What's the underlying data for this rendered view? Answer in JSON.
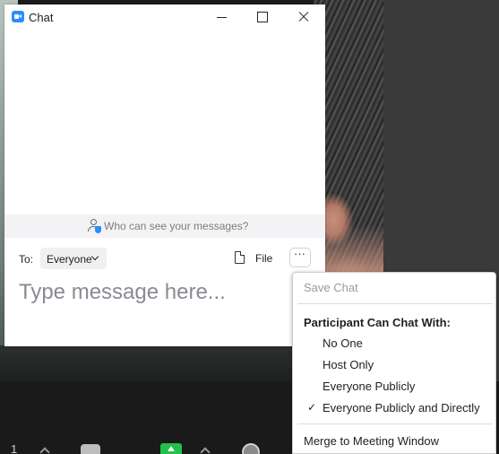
{
  "chat_window": {
    "title": "Chat",
    "privacy_notice": "Who can see your messages?",
    "to_label": "To:",
    "recipient": "Everyone",
    "file_label": "File",
    "more_label": "···",
    "message_placeholder": "Type message here..."
  },
  "menu": {
    "save_chat": "Save Chat",
    "heading": "Participant Can Chat With:",
    "options": [
      {
        "label": "No One",
        "checked": false
      },
      {
        "label": "Host Only",
        "checked": false
      },
      {
        "label": "Everyone Publicly",
        "checked": false
      },
      {
        "label": "Everyone Publicly and Directly",
        "checked": true
      }
    ],
    "check_glyph": "✓",
    "merge": "Merge to Meeting Window"
  },
  "toolbar": {
    "participant_count": "1"
  },
  "colors": {
    "accent": "#2d8cff",
    "share_green": "#23c04b"
  }
}
